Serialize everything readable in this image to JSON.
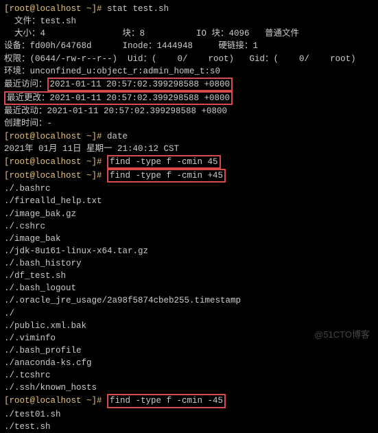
{
  "prompt1": "[root@localhost ~]# ",
  "cmd_stat": "stat test.sh",
  "stat_file": "  文件：test.sh",
  "stat_size": "  大小：4               块：8          IO 块：4096   普通文件",
  "stat_dev": "设备：fd00h/64768d      Inode：1444948     硬链接：1",
  "stat_perm": "权限：(0644/-rw-r--r--)  Uid：(    0/    root)   Gid：(    0/    root)",
  "stat_env": "环境：unconfined_u:object_r:admin_home_t:s0",
  "stat_atime_lbl": "最近访问：",
  "stat_atime_val": "2021-01-11 20:57:02.399298588 +0800",
  "stat_mtime_lbl": "最近更改：",
  "stat_mtime_val": "2021-01-11 20:57:02.399298588 +0800",
  "stat_ctime": "最近改动：2021-01-11 20:57:02.399298588 +0800",
  "stat_birth": "创建时间：-",
  "cmd_date": "date",
  "date_out": "2021年 01月 11日 星期一 21:40:12 CST",
  "cmd_find1": "find -type f -cmin 45",
  "cmd_find2": "find -type f -cmin +45",
  "files": [
    "./.bashrc",
    "./firealld_help.txt",
    "./image_bak.gz",
    "./.cshrc",
    "./image_bak",
    "./jdk-8u161-linux-x64.tar.gz",
    "./.bash_history",
    "./df_test.sh",
    "./.bash_logout",
    "./.oracle_jre_usage/2a98f5874cbeb255.timestamp",
    "./",
    "./public.xml.bak",
    "./.viminfo",
    "./.bash_profile",
    "./anaconda-ks.cfg",
    "./.tcshrc",
    "./.ssh/known_hosts"
  ],
  "cmd_find3": "find -type f -cmin -45",
  "files2": [
    "./test01.sh",
    "./test.sh"
  ],
  "watermark": "@51CTO博客"
}
